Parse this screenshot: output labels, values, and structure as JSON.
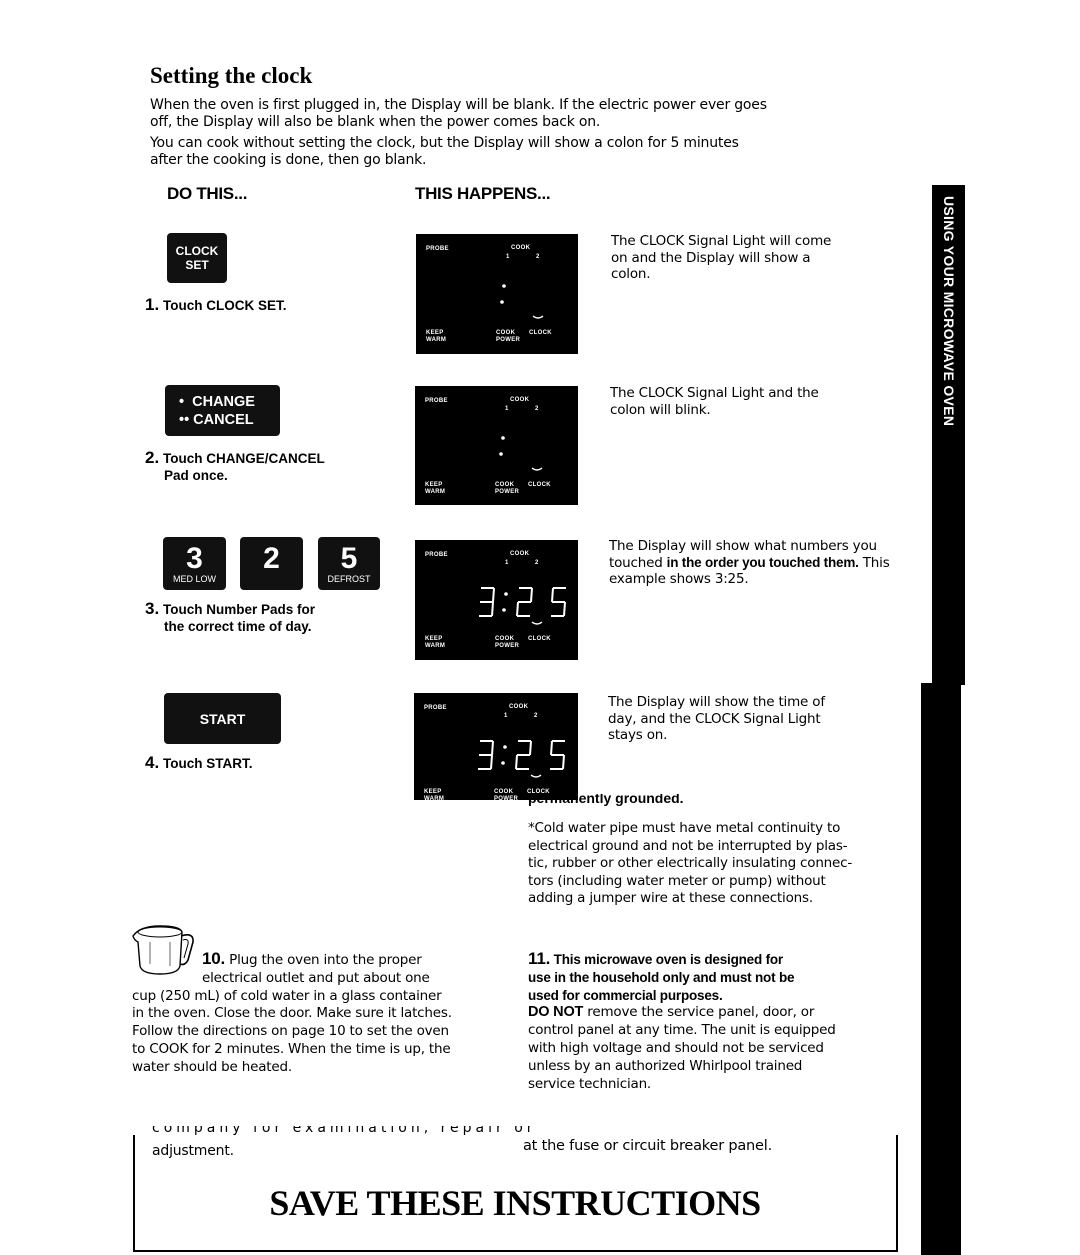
{
  "page": {
    "title": "Setting the clock",
    "intro_paragraphs": [
      [
        "When the oven is first plugged in, the Display will be blank. If the electric power ever goes",
        "off, the Display will also be blank when the power comes back on."
      ],
      [
        "You can cook without setting the clock, but the Display will show a colon for 5 minutes",
        "after the cooking is done, then go blank."
      ]
    ],
    "column_headers": {
      "do_this": "DO THIS...",
      "this_happens": "THIS HAPPENS..."
    },
    "side_tab": "USING YOUR MICROWAVE OVEN"
  },
  "display_labels": {
    "probe": "PROBE",
    "cook": "COOK",
    "cook_1": "1",
    "cook_2": "2",
    "keep": "KEEP",
    "warm": "WARM",
    "cook_power_1": "COOK",
    "cook_power_2": "POWER",
    "clock": "CLOCK"
  },
  "steps": [
    {
      "number": "1.",
      "instruction_lines": [
        "Touch CLOCK SET."
      ],
      "pads": [
        {
          "lines": [
            "CLOCK",
            "SET"
          ]
        }
      ],
      "display_value": ":",
      "result": "The CLOCK Signal Light will come on and the Display will show a colon."
    },
    {
      "number": "2.",
      "instruction_lines": [
        "Touch CHANGE/CANCEL",
        "Pad once."
      ],
      "pads": [
        {
          "lines": [
            "•  CHANGE",
            "•• CANCEL"
          ]
        }
      ],
      "display_value": ":",
      "result": "The CLOCK Signal Light and the colon will blink."
    },
    {
      "number": "3.",
      "instruction_lines": [
        "Touch Number Pads for",
        "the correct time of day."
      ],
      "pads": [
        {
          "digit": "3",
          "sub": "MED LOW"
        },
        {
          "digit": "2",
          "sub": ""
        },
        {
          "digit": "5",
          "sub": "DEFROST"
        }
      ],
      "display_value": "3:25",
      "result_before": "The Display will show what numbers you touched ",
      "result_bold": "in the order you touched them.",
      "result_after": " This example shows 3:25."
    },
    {
      "number": "4.",
      "instruction_lines": [
        "Touch START."
      ],
      "pads": [
        {
          "lines": [
            "START"
          ]
        }
      ],
      "display_value": "3:25",
      "result": "The Display will show the time of day, and the CLOCK Signal Light stays on."
    }
  ],
  "grounding": {
    "heading_fragment": "permanently grounded.",
    "footnote_lines": [
      "*Cold water pipe must have metal continuity to",
      "electrical ground and not be interrupted by plas-",
      "tic, rubber or other electrically insulating connec-",
      "tors (including water meter or pump) without",
      "adding a jumper wire at these connections."
    ]
  },
  "item10": {
    "number": "10.",
    "icon": "measuring-cup-icon",
    "lines": [
      "Plug the oven into the proper",
      "electrical outlet and put about one",
      "cup (250 mL) of cold water in a glass container",
      "in the oven. Close the door. Make sure it latches.",
      "Follow the directions on page 10 to set the oven",
      "to COOK for 2 minutes. When the time is up, the",
      "water should be heated."
    ]
  },
  "item11": {
    "number": "11.",
    "bold_lines": [
      "This microwave oven is designed for",
      "use in the household only and must not be",
      "used for commercial purposes."
    ],
    "do_not": "DO NOT",
    "lines": [
      " remove the service panel, door, or",
      "control panel at any time. The unit is equipped",
      "with high voltage and should not be serviced",
      "unless by an authorized Whirlpool trained",
      "service technician."
    ]
  },
  "footer": {
    "left_cut_line": "company for examination, repair or",
    "left_last_line": "adjustment.",
    "right_line": "at the fuse or circuit breaker panel.",
    "save_instructions": "SAVE THESE INSTRUCTIONS"
  }
}
